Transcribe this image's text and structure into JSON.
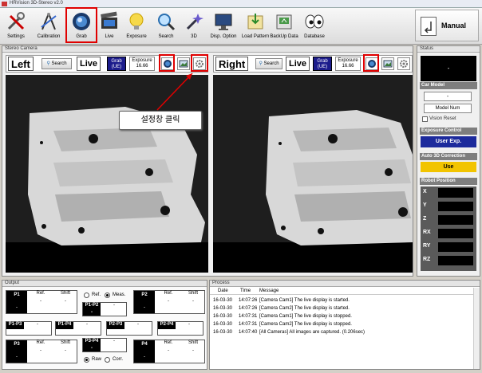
{
  "window": {
    "title": "HRVision 3D-Stereo v2.0"
  },
  "toolbar": {
    "buttons": [
      {
        "label": "Settings",
        "icon": "tools-icon"
      },
      {
        "label": "Calibration",
        "icon": "compass-icon"
      },
      {
        "label": "Grab",
        "icon": "grab-icon"
      },
      {
        "label": "Live",
        "icon": "film-icon"
      },
      {
        "label": "Exposure",
        "icon": "bulb-icon"
      },
      {
        "label": "Search",
        "icon": "magnifier-icon"
      },
      {
        "label": "3D",
        "icon": "wand-icon"
      },
      {
        "label": "Disp. Option",
        "icon": "display-icon"
      },
      {
        "label": "Load Pattern",
        "icon": "load-icon"
      },
      {
        "label": "BackUp Data",
        "icon": "backup-icon"
      },
      {
        "label": "Database",
        "icon": "eyes-icon"
      }
    ],
    "mode_label": "Manual"
  },
  "stereo": {
    "title": "Stereo Camera",
    "left": {
      "name": "Left",
      "search": "Search",
      "live": "Live",
      "grab_line1": "Grab",
      "grab_line2": "(UE)",
      "exp_label": "Exposure",
      "exp_value": "16.66"
    },
    "right": {
      "name": "Right",
      "search": "Search",
      "live": "Live",
      "grab_line1": "Grab",
      "grab_line2": "(UE)",
      "exp_label": "Exposure",
      "exp_value": "16.66"
    },
    "callout": "설정창 클릭"
  },
  "status": {
    "title": "Status",
    "status_value": "-",
    "car_model_title": "Car Model",
    "car_model_value": "-",
    "model_num_label": "Model Num",
    "vision_reset_label": "Vision Reset",
    "exposure_control_title": "Exposure Control",
    "user_exp_label": "User Exp.",
    "auto3d_title": "Auto 3D Correction",
    "use_label": "Use",
    "robot_title": "Robot Position",
    "robot_axes": [
      "X",
      "Y",
      "Z",
      "RX",
      "RY",
      "RZ"
    ]
  },
  "output": {
    "title": "Output",
    "col_ref": "Ref.",
    "col_shift": "Shift",
    "dash": "-",
    "radio_ref": "Ref.",
    "radio_meas": "Meas.",
    "radio_raw": "Raw",
    "radio_corr": "Corr.",
    "points": [
      "P1",
      "P2",
      "P3",
      "P4"
    ],
    "pairs": [
      "P1-P2",
      "P1-P3",
      "P1-P4",
      "P2-P3",
      "P2-P4",
      "P3-P4"
    ]
  },
  "process": {
    "title": "Process",
    "headers": [
      "Date",
      "Time",
      "Message"
    ],
    "rows": [
      {
        "date": "16-03-30",
        "time": "14:07:26",
        "msg": "[Camera Cam1] The live display is started."
      },
      {
        "date": "16-03-30",
        "time": "14:07:26",
        "msg": "[Camera Cam2] The live display is started."
      },
      {
        "date": "16-03-30",
        "time": "14:07:31",
        "msg": "[Camera Cam1] The live display is stopped."
      },
      {
        "date": "16-03-30",
        "time": "14:07:31",
        "msg": "[Camera Cam2] The live display is stopped."
      },
      {
        "date": "16-03-30",
        "time": "14:07:40",
        "msg": "[All Cameras] All images are captured. (0.206sec)"
      }
    ]
  },
  "colors": {
    "highlight": "#e00000",
    "grab_button": "#1c1c8c",
    "status_header": "#7e7e7e"
  }
}
